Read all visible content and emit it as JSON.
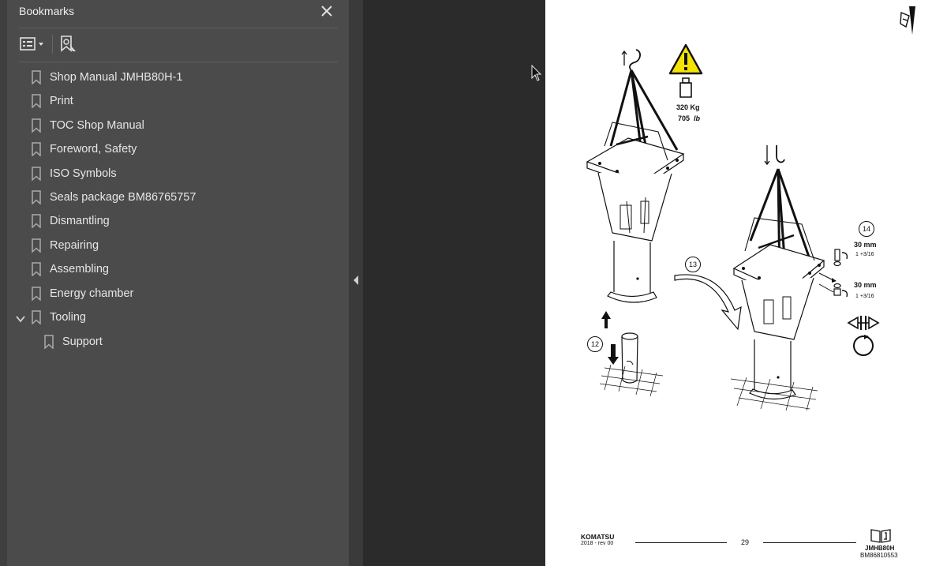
{
  "sidebar": {
    "title": "Bookmarks",
    "close_icon": "close-icon",
    "toolbar": {
      "options_icon": "bookmark-options-icon",
      "find_icon": "find-current-bookmark-icon"
    },
    "items": [
      {
        "label": "Shop Manual JMHB80H-1"
      },
      {
        "label": "Print"
      },
      {
        "label": "TOC Shop Manual"
      },
      {
        "label": "Foreword, Safety"
      },
      {
        "label": "ISO Symbols"
      },
      {
        "label": "Seals package BM86765757"
      },
      {
        "label": "Dismantling"
      },
      {
        "label": "Repairing"
      },
      {
        "label": "Assembling"
      },
      {
        "label": "Energy chamber"
      },
      {
        "label": "Tooling"
      },
      {
        "label": "Support"
      }
    ]
  },
  "page": {
    "weight_kg": "320 Kg",
    "weight_lb_value": "705",
    "weight_lb_unit": "lb",
    "step_12": "12",
    "step_13": "13",
    "step_14": "14",
    "torque_size_1": "30 mm",
    "torque_turn_1": "1 +3/16",
    "torque_size_2": "30 mm",
    "torque_turn_2": "1 +3/16",
    "footer": {
      "brand": "KOMATSU",
      "year_rev": "2018 -  rev 00",
      "page_number": "29",
      "model": "JMHB80H",
      "doc_code": "BM86810553"
    }
  },
  "colors": {
    "panel_bg": "#4b4b4b",
    "doc_bg": "#2b2b2b",
    "warning_yellow": "#f5e400"
  }
}
